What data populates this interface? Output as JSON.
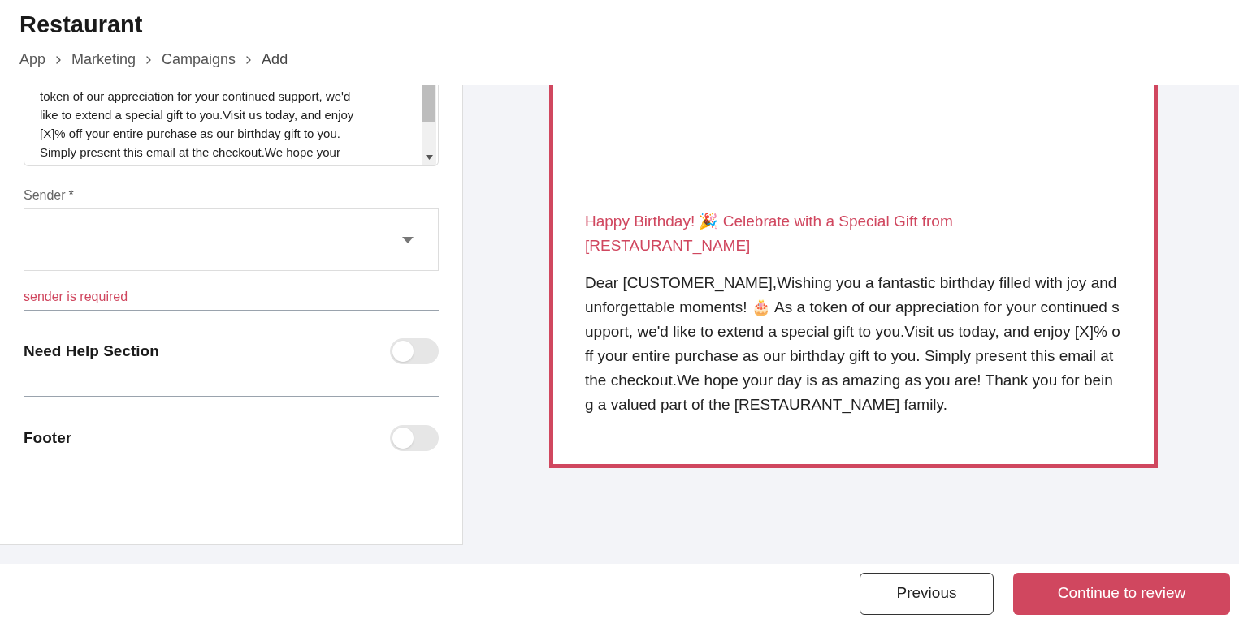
{
  "header": {
    "title": "Restaurant",
    "breadcrumb": [
      "App",
      "Marketing",
      "Campaigns",
      "Add"
    ]
  },
  "message_field": {
    "lines": [
      "token of our appreciation for your continued support, we'd",
      "like to extend a special gift to you.Visit us today, and enjoy",
      "[X]% off your entire purchase as our birthday gift to you.",
      "Simply present this email at the checkout.We hope your"
    ]
  },
  "sender": {
    "label": "Sender",
    "required_mark": "*",
    "error": "sender is required"
  },
  "sections": [
    {
      "label": "Need Help Section",
      "on": false
    },
    {
      "label": "Footer",
      "on": false
    }
  ],
  "preview": {
    "subject": "Happy Birthday! 🎉 Celebrate with a Special Gift from [RESTAURANT_NAME]",
    "body": "Dear [CUSTOMER_NAME],Wishing you a fantastic birthday filled with joy and unforgettable moments! 🎂 As a token of our appreciation for your continued support, we'd like to extend a special gift to you.Visit us today, and enjoy [X]% off your entire purchase as our birthday gift to you. Simply present this email at the checkout.We hope your day is as amazing as you are! Thank you for being a valued part of the [RESTAURANT_NAME] family."
  },
  "buttons": {
    "previous": "Previous",
    "continue": "Continue to review"
  }
}
